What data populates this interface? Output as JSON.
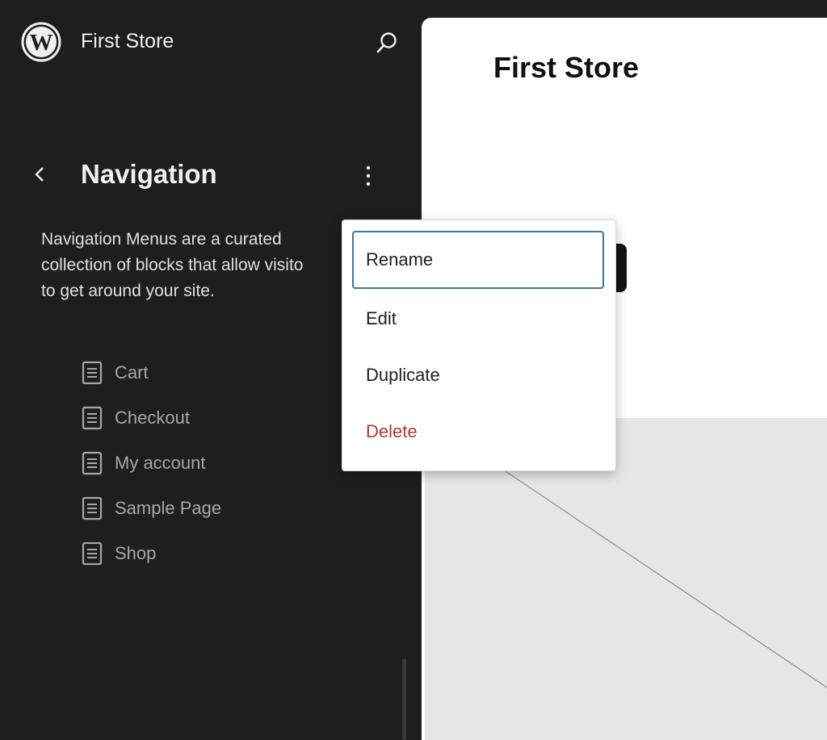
{
  "header": {
    "site_name": "First Store",
    "logo_icon": "wordpress-logo-icon",
    "search_icon": "search-icon"
  },
  "navigation_panel": {
    "title": "Navigation",
    "back_icon": "chevron-left-icon",
    "more_icon": "more-vertical-icon",
    "description_lines": [
      "Navigation Menus are a curated",
      "collection of blocks that allow visito",
      "to get around your site."
    ],
    "items": [
      {
        "label": "Cart",
        "icon": "page-icon"
      },
      {
        "label": "Checkout",
        "icon": "page-icon"
      },
      {
        "label": "My account",
        "icon": "page-icon"
      },
      {
        "label": "Sample Page",
        "icon": "page-icon"
      },
      {
        "label": "Shop",
        "icon": "page-icon"
      }
    ]
  },
  "dropdown_menu": {
    "items": [
      {
        "label": "Rename",
        "state": "focused"
      },
      {
        "label": "Edit"
      },
      {
        "label": "Duplicate"
      },
      {
        "label": "Delete",
        "color": "#b3373c"
      }
    ]
  },
  "preview": {
    "site_title": "First Store"
  },
  "colors": {
    "sidebar_bg": "#1e1e1e",
    "focus_border": "#3c78a8",
    "danger": "#b3373c",
    "preview_bg": "#ffffff",
    "placeholder_bg": "#e6e6e6"
  }
}
